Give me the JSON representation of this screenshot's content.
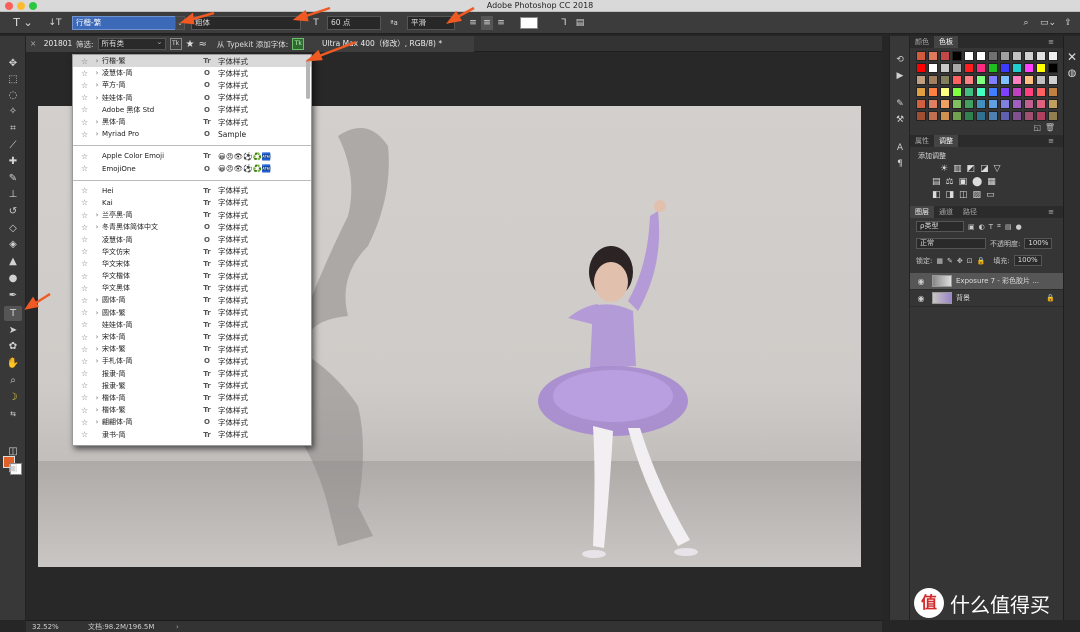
{
  "window": {
    "title": "Adobe Photoshop CC 2018"
  },
  "options_bar": {
    "tool_icon": "type-tool-icon",
    "font_family": "行楷-繁",
    "font_style": "粗体",
    "font_size": "60 点",
    "aa_label": "ªa",
    "antialias": "平滑"
  },
  "tab_bar": {
    "doc_prefix": "201801",
    "filter_label": "筛选:",
    "filter_value": "所有类",
    "typekit_label": "从 Typekit 添加字体:",
    "doc_suffix": "Ultra Max 400（修改）, RGB/8) *"
  },
  "font_list": {
    "group1": [
      {
        "name": "行楷-繁",
        "expand": "›",
        "type": "Tr",
        "sample": "字体样式",
        "highlight": true
      },
      {
        "name": "凌慧体-简",
        "expand": "›",
        "type": "O",
        "sample": "字体样式"
      },
      {
        "name": "苹方-简",
        "expand": "›",
        "type": "O",
        "sample": "字体样式"
      },
      {
        "name": "娃娃体-简",
        "expand": "›",
        "type": "O",
        "sample": "字体样式"
      },
      {
        "name": "Adobe 黑体 Std",
        "expand": "",
        "type": "O",
        "sample": "字体样式"
      },
      {
        "name": "黑体-简",
        "expand": "›",
        "type": "Tr",
        "sample": "字体样式"
      },
      {
        "name": "Myriad Pro",
        "expand": "›",
        "type": "O",
        "sample": "Sample"
      }
    ],
    "group2": [
      {
        "name": "Apple Color Emoji",
        "expand": "",
        "type": "Tr",
        "sample": "😀😠👁⚽♻️🏧"
      },
      {
        "name": "EmojiOne",
        "expand": "",
        "type": "O",
        "sample": "😀😠👁⚽♻️🏧"
      }
    ],
    "group3": [
      {
        "name": "Hei",
        "expand": "",
        "type": "Tr",
        "sample": "字体样式"
      },
      {
        "name": "Kai",
        "expand": "",
        "type": "Tr",
        "sample": "字体样式"
      },
      {
        "name": "兰亭黑-简",
        "expand": "›",
        "type": "Tr",
        "sample": "字体样式"
      },
      {
        "name": "冬青黑体简体中文",
        "expand": "›",
        "type": "O",
        "sample": "字体样式"
      },
      {
        "name": "凌慧体-简",
        "expand": "",
        "type": "O",
        "sample": "字体样式"
      },
      {
        "name": "华文仿宋",
        "expand": "",
        "type": "Tr",
        "sample": "字体样式"
      },
      {
        "name": "华文宋体",
        "expand": "",
        "type": "Tr",
        "sample": "字体样式"
      },
      {
        "name": "华文楷体",
        "expand": "",
        "type": "Tr",
        "sample": "字体样式"
      },
      {
        "name": "华文黑体",
        "expand": "",
        "type": "Tr",
        "sample": "字体样式"
      },
      {
        "name": "圆体-简",
        "expand": "›",
        "type": "Tr",
        "sample": "字体样式"
      },
      {
        "name": "圆体-繁",
        "expand": "›",
        "type": "Tr",
        "sample": "字体样式"
      },
      {
        "name": "娃娃体-简",
        "expand": "",
        "type": "Tr",
        "sample": "字体样式"
      },
      {
        "name": "宋体-简",
        "expand": "›",
        "type": "Tr",
        "sample": "字体样式"
      },
      {
        "name": "宋体-繁",
        "expand": "›",
        "type": "Tr",
        "sample": "字体样式"
      },
      {
        "name": "手札体-简",
        "expand": "›",
        "type": "O",
        "sample": "字体样式"
      },
      {
        "name": "报隶-简",
        "expand": "",
        "type": "Tr",
        "sample": "字体样式"
      },
      {
        "name": "报隶-繁",
        "expand": "",
        "type": "Tr",
        "sample": "字体样式"
      },
      {
        "name": "楷体-简",
        "expand": "›",
        "type": "Tr",
        "sample": "字体样式"
      },
      {
        "name": "楷体-繁",
        "expand": "›",
        "type": "Tr",
        "sample": "字体样式"
      },
      {
        "name": "翩翩体-简",
        "expand": "›",
        "type": "O",
        "sample": "字体样式"
      },
      {
        "name": "隶书-简",
        "expand": "",
        "type": "Tr",
        "sample": "字体样式"
      }
    ]
  },
  "panels": {
    "swatch_tabs": [
      "颜色",
      "色板"
    ],
    "swatches": [
      "#d45a3a",
      "#e07a5a",
      "#c04848",
      "#000000",
      "#ffffff",
      "#ffffff",
      "#707070",
      "#a0a0a0",
      "#c0c0c0",
      "#d0d0d0",
      "#e0e0e0",
      "#f0f0f0",
      "#ff0000",
      "#ffffff",
      "#c8c8c8",
      "#a8a8a8",
      "#ff1e1e",
      "#ff2a80",
      "#1ec01e",
      "#3c3cff",
      "#1ecfcf",
      "#ff40ff",
      "#ffff00",
      "#000000",
      "#c0a080",
      "#a08060",
      "#808060",
      "#ff6060",
      "#ff8080",
      "#80ff80",
      "#8080ff",
      "#80c0ff",
      "#ff80c0",
      "#ffc080",
      "#c0c0c0",
      "#d0d0d0",
      "#e0a040",
      "#ff8040",
      "#ffff80",
      "#80ff40",
      "#40c080",
      "#40ffc0",
      "#4080ff",
      "#8040ff",
      "#c040c0",
      "#ff4080",
      "#ff6060",
      "#c08040",
      "#d06040",
      "#e08060",
      "#f0a060",
      "#80c060",
      "#40a060",
      "#4090c0",
      "#60a0e0",
      "#8080e0",
      "#a060c0",
      "#c06090",
      "#e06080",
      "#c0a060",
      "#a05030",
      "#c07050",
      "#d09050",
      "#70a050",
      "#308050",
      "#307090",
      "#5080b0",
      "#6060b0",
      "#805090",
      "#a05070",
      "#b04060",
      "#908050"
    ],
    "adjust_tabs": [
      "属性",
      "调整"
    ],
    "adjust_title": "添加调整",
    "adjust_row1": [
      "☀",
      "▥",
      "◩",
      "◪",
      "▽"
    ],
    "adjust_row2": [
      "▤",
      "⚖",
      "▣",
      "⬤",
      "▦"
    ],
    "adjust_row3": [
      "◧",
      "◨",
      "◫",
      "▨",
      "▭"
    ],
    "layer_tabs": [
      "图层",
      "通道",
      "路径"
    ],
    "kind_label": "ρ类型",
    "blend_mode": "正常",
    "opacity_label": "不透明度:",
    "opacity_value": "100%",
    "lock_label": "锁定:",
    "fill_label": "填充:",
    "fill_value": "100%",
    "layers": [
      {
        "name": "Exposure 7 - 彩色胶片 ...",
        "selected": true
      },
      {
        "name": "背景",
        "selected": false
      }
    ]
  },
  "status_bar": {
    "zoom": "32.52%",
    "doc": "文档:98.2M/196.5M",
    "arrow": "›"
  },
  "watermark": {
    "logo": "值",
    "text": "什么值得买"
  },
  "colors": {
    "foreground": "#e0602a",
    "background": "#ffffff",
    "arrow": "#f05a22"
  }
}
